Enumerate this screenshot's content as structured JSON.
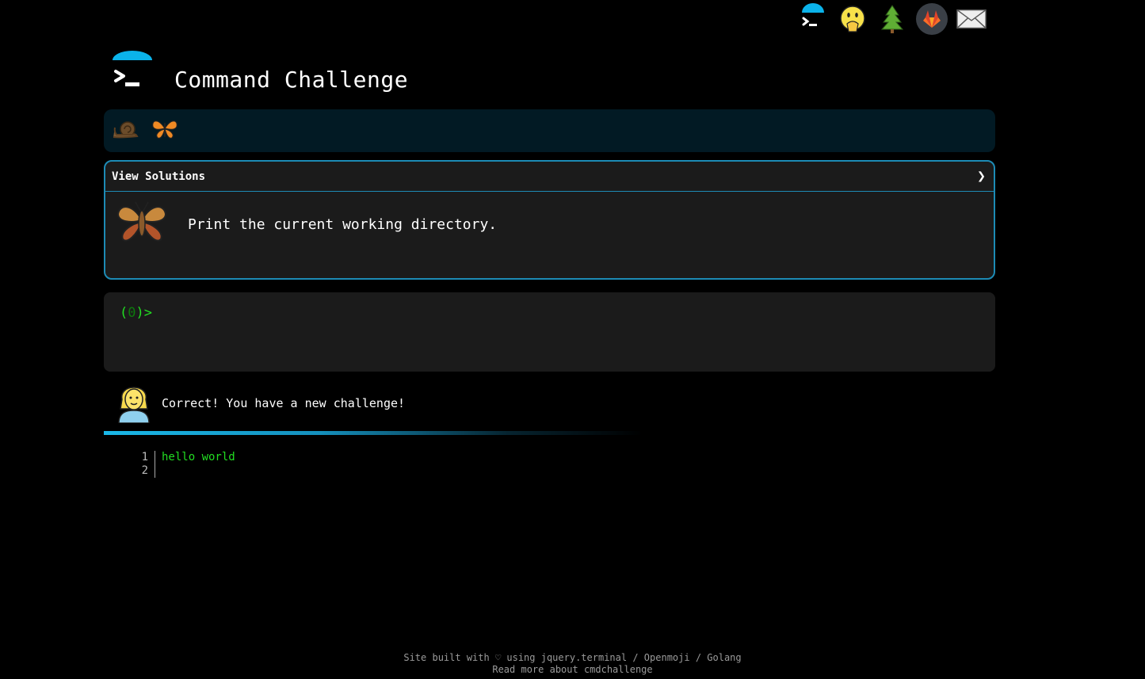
{
  "header": {
    "title": "Command Challenge"
  },
  "top_icons": [
    "terminal-logo-icon",
    "hand-over-mouth-face-icon",
    "tree-icon",
    "gitlab-icon",
    "envelope-icon"
  ],
  "progress": {
    "icons": [
      "snail-icon",
      "butterfly-icon"
    ]
  },
  "challenge": {
    "view_solutions": "View Solutions",
    "chevron": "❯",
    "description": "Print the current working directory."
  },
  "terminal": {
    "prompt_open": "(",
    "prompt_code": "0",
    "prompt_close": ")>"
  },
  "message": {
    "text": "Correct! You have a new challenge!"
  },
  "editor": {
    "line_numbers": [
      "1",
      "2"
    ],
    "lines": [
      "hello world",
      ""
    ]
  },
  "footer": {
    "prefix": "Site built with ♡ using ",
    "link1": "jquery.terminal",
    "sep1": " / ",
    "link2": "Openmoji",
    "sep2": " / ",
    "link3": "Golang",
    "read_more": "Read more about cmdchallenge"
  },
  "colors": {
    "accent": "#1d8bb5",
    "terminal_green": "#22dd22",
    "panel": "#1b1b1b",
    "progress_bg": "#021a24"
  }
}
